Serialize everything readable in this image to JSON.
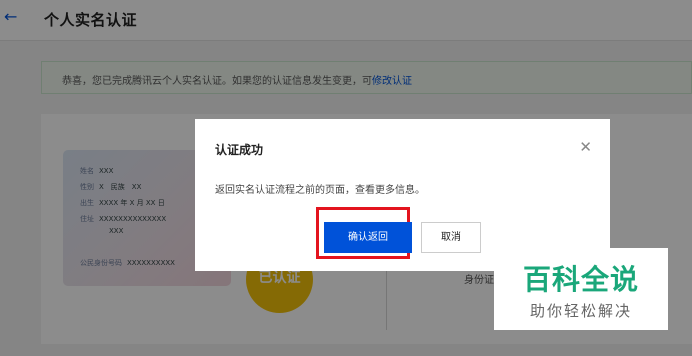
{
  "header": {
    "back_icon": "arrow-left-icon",
    "title": "个人实名认证"
  },
  "notice": {
    "text": "恭喜，您已完成腾讯云个人实名认证。如果您的认证信息发生变更，可",
    "link": "修改认证"
  },
  "id_card": {
    "rows": [
      {
        "label": "姓名",
        "value": "XXX"
      },
      {
        "label": "性别",
        "value": "X　民族　XX"
      },
      {
        "label": "出生",
        "value": "XXXX 年 X 月 XX 日"
      },
      {
        "label": "住址",
        "value": "XXXXXXXXXXXXXX"
      },
      {
        "label": "",
        "value": "XXX"
      },
      {
        "label": "公民身份号码",
        "value": "XXXXXXXXXX"
      }
    ]
  },
  "stamp": "已认证",
  "side_text": "身份证",
  "dialog": {
    "title": "认证成功",
    "close_icon": "close-icon",
    "message": "返回实名认证流程之前的页面，查看更多信息。",
    "confirm_label": "确认返回",
    "cancel_label": "取消"
  },
  "watermark": {
    "title": "百科全说",
    "subtitle": "助你轻松解决"
  },
  "colors": {
    "primary": "#0052d9",
    "highlight": "#e3141e",
    "stamp": "#f2c20a",
    "watermark": "#1aa77a"
  }
}
